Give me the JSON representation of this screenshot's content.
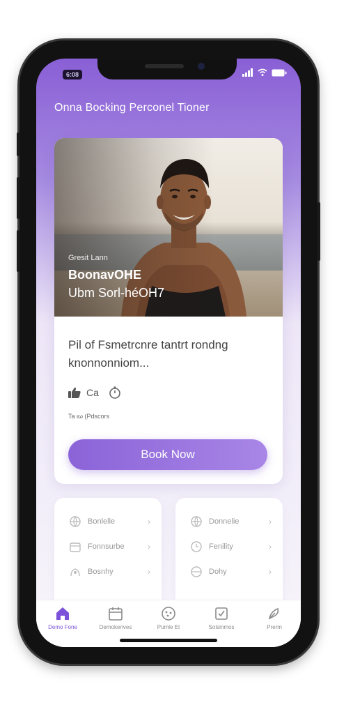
{
  "status_bar": {
    "badge": "6:08"
  },
  "header": {
    "title": "Onna Bocking Perconel Tioner"
  },
  "trainer_card": {
    "subtitle": "Gresit Lann",
    "name": "BoonavOHE",
    "detail": "Ubm Sorl-héOH7",
    "description": "Pil of Fsmetrcnre tantrt rondng knonnonniom...",
    "likes": "Ca",
    "meta": "Ta ιω (Pdscors",
    "book_button": "Book Now"
  },
  "mini_cards": [
    {
      "items": [
        {
          "icon": "globe-icon",
          "label": "Bonlelle"
        },
        {
          "icon": "calendar-icon",
          "label": "Fonnsurbe"
        },
        {
          "icon": "hands-icon",
          "label": "Bosnhy"
        }
      ]
    },
    {
      "items": [
        {
          "icon": "globe-icon",
          "label": "Donnelie"
        },
        {
          "icon": "clock-icon",
          "label": "Fenility"
        },
        {
          "icon": "globe-icon",
          "label": "Dohy"
        }
      ]
    }
  ],
  "tabs": [
    {
      "label": "Demo Fone",
      "icon": "home-icon",
      "active": true
    },
    {
      "label": "Demokenves",
      "icon": "calendar-icon",
      "active": false
    },
    {
      "label": "Pumle Et",
      "icon": "cookie-icon",
      "active": false
    },
    {
      "label": "Solsinmos",
      "icon": "checklist-icon",
      "active": false
    },
    {
      "label": "Prerm",
      "icon": "feather-icon",
      "active": false
    }
  ],
  "colors": {
    "accent": "#8b63d8",
    "accent_light": "#a886e6",
    "header_gradient_top": "#8a5fd6"
  }
}
